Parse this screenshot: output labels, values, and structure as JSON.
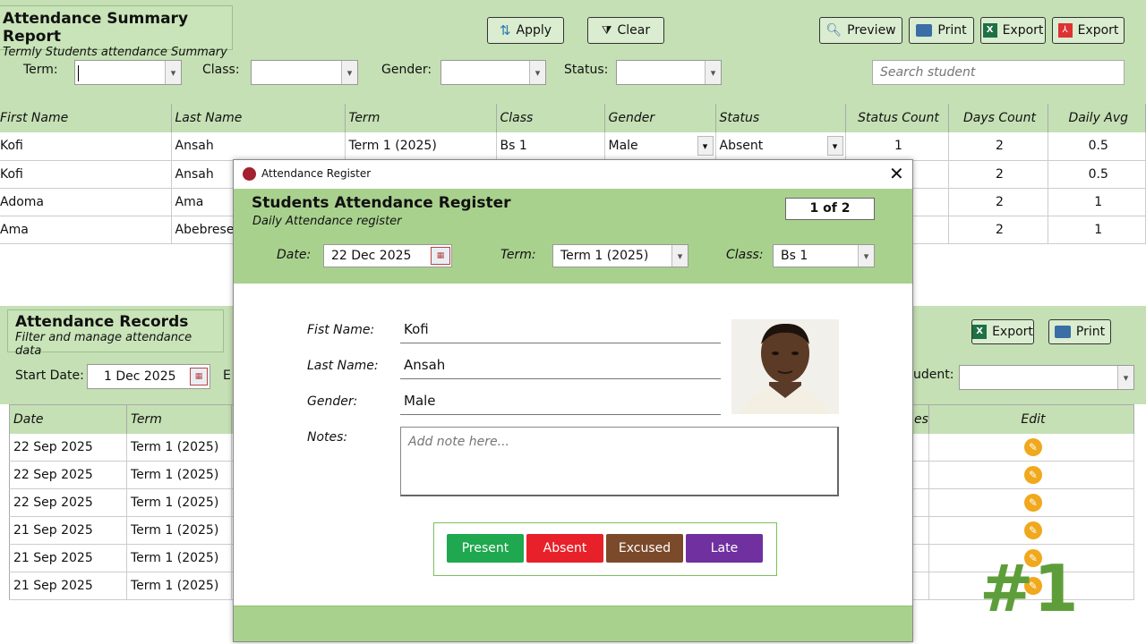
{
  "summary": {
    "title": "Attendance Summary Report",
    "subtitle": "Termly Students attendance Summary"
  },
  "toolbar": {
    "apply": "Apply",
    "clear": "Clear",
    "preview": "Preview",
    "print": "Print",
    "export_excel": "Export",
    "export_pdf": "Export"
  },
  "filters": {
    "term_label": "Term:",
    "class_label": "Class:",
    "gender_label": "Gender:",
    "status_label": "Status:",
    "search_placeholder": "Search student"
  },
  "summary_table": {
    "headers": [
      "First Name",
      "Last Name",
      "Term",
      "Class",
      "Gender",
      "Status",
      "Status Count",
      "Days Count",
      "Daily Avg"
    ],
    "rows": [
      [
        "Kofi",
        "Ansah",
        "Term 1 (2025)",
        "Bs 1",
        "Male",
        "Absent",
        "1",
        "2",
        "0.5"
      ],
      [
        "Kofi",
        "Ansah",
        "",
        "",
        "",
        "",
        "",
        "2",
        "0.5"
      ],
      [
        "Adoma",
        "Ama",
        "",
        "",
        "",
        "",
        "",
        "2",
        "1"
      ],
      [
        "Ama",
        "Abebrese",
        "",
        "",
        "",
        "",
        "",
        "2",
        "1"
      ]
    ]
  },
  "records": {
    "title": "Attendance Records",
    "subtitle": "Filter and manage attendance data",
    "start_label": "Start Date:",
    "start_value": "1 Dec 2025",
    "e_label": "E",
    "student_label": "udent:",
    "export": "Export",
    "print": "Print",
    "headers": {
      "date": "Date",
      "term": "Term",
      "notes": "es",
      "edit": "Edit"
    },
    "rows": [
      [
        "22 Sep 2025",
        "Term 1 (2025)"
      ],
      [
        "22 Sep 2025",
        "Term 1 (2025)"
      ],
      [
        "22 Sep 2025",
        "Term 1 (2025)"
      ],
      [
        "21 Sep 2025",
        "Term 1 (2025)"
      ],
      [
        "21 Sep 2025",
        "Term 1 (2025)"
      ],
      [
        "21 Sep 2025",
        "Term 1 (2025)"
      ]
    ]
  },
  "dialog": {
    "window_title": "Attendance Register",
    "title": "Students Attendance Register",
    "subtitle": "Daily Attendance register",
    "counter": "1 of 2",
    "date_label": "Date:",
    "date_value": "22 Dec 2025",
    "term_label": "Term:",
    "term_value": "Term 1 (2025)",
    "class_label": "Class:",
    "class_value": "Bs 1",
    "first_label": "Fist Name:",
    "first_value": "Kofi",
    "last_label": "Last Name:",
    "last_value": "Ansah",
    "gender_label": "Gender:",
    "gender_value": "Male",
    "notes_label": "Notes:",
    "notes_placeholder": "Add note here...",
    "buttons": {
      "present": "Present",
      "absent": "Absent",
      "excused": "Excused",
      "late": "Late"
    }
  },
  "watermark": "#1",
  "colors": {
    "present": "#1fa84f",
    "absent": "#e8202a",
    "excused": "#7b4a2a",
    "late": "#7030a0"
  }
}
